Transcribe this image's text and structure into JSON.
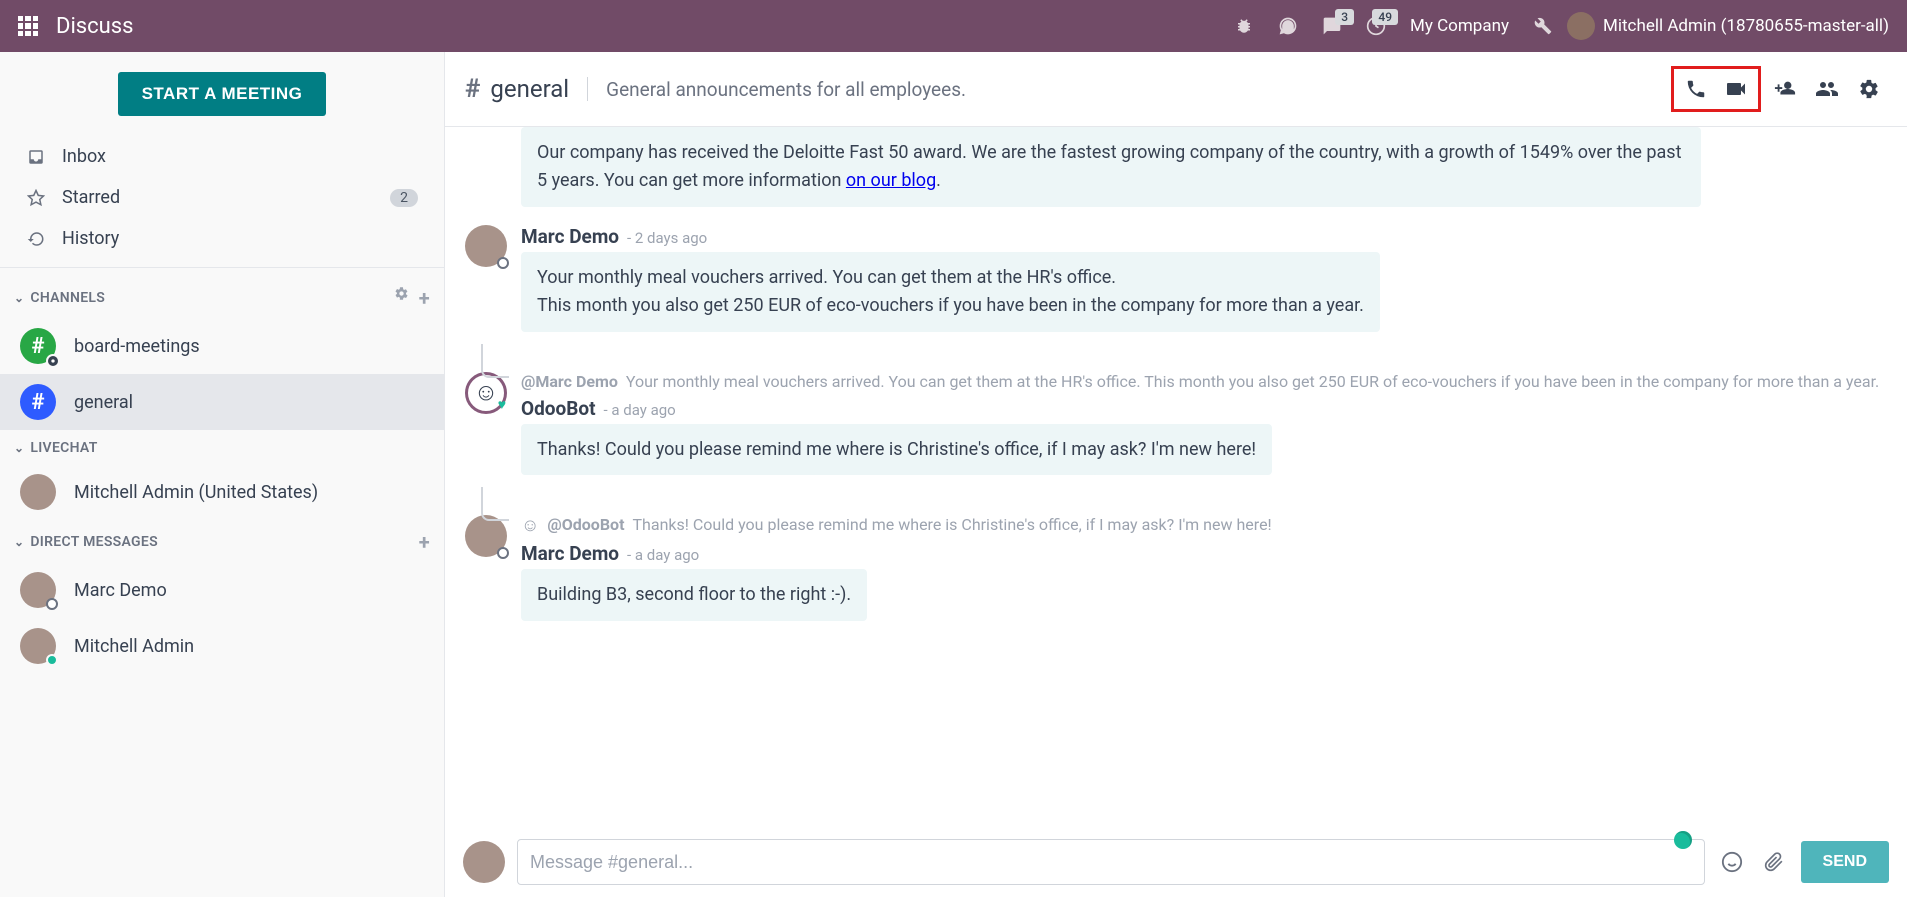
{
  "topbar": {
    "title": "Discuss",
    "messages_badge": "3",
    "activities_badge": "49",
    "company": "My Company",
    "username": "Mitchell Admin (18780655-master-all)"
  },
  "sidebar": {
    "meeting_button": "START A MEETING",
    "nav": {
      "inbox": "Inbox",
      "starred": "Starred",
      "starred_count": "2",
      "history": "History"
    },
    "channels_label": "CHANNELS",
    "channels": [
      {
        "name": "board-meetings"
      },
      {
        "name": "general"
      }
    ],
    "livechat_label": "LIVECHAT",
    "livechat": [
      {
        "name": "Mitchell Admin (United States)"
      }
    ],
    "dm_label": "DIRECT MESSAGES",
    "dms": [
      {
        "name": "Marc Demo"
      },
      {
        "name": "Mitchell Admin"
      }
    ]
  },
  "channel": {
    "name": "general",
    "description": "General announcements for all employees."
  },
  "messages": {
    "m0": {
      "body_1": "Our company has received the Deloitte Fast 50 award. We are the fastest growing company of the country, with a growth of 1549% over the past 5 years. You can get more information ",
      "link": "on our blog",
      "body_2": "."
    },
    "m1": {
      "author": "Marc Demo",
      "time": "- 2 days ago",
      "body": "Your monthly meal vouchers arrived. You can get them at the HR's office.\nThis month you also get 250 EUR of eco-vouchers if you have been in the company for more than a year."
    },
    "m2": {
      "reply_author": "@Marc Demo",
      "reply_text": "Your monthly meal vouchers arrived. You can get them at the HR's office. This month you also get 250 EUR of eco-vouchers if you have been in the company for more than a year.",
      "author": "OdooBot",
      "time": "- a day ago",
      "body": "Thanks! Could you please remind me where is Christine's office, if I may ask? I'm new here!"
    },
    "m3": {
      "reply_author": "@OdooBot",
      "reply_text": "Thanks! Could you please remind me where is Christine's office, if I may ask? I'm new here!",
      "author": "Marc Demo",
      "time": "- a day ago",
      "body": "Building B3, second floor to the right :-)."
    }
  },
  "composer": {
    "placeholder": "Message #general...",
    "send": "SEND"
  }
}
